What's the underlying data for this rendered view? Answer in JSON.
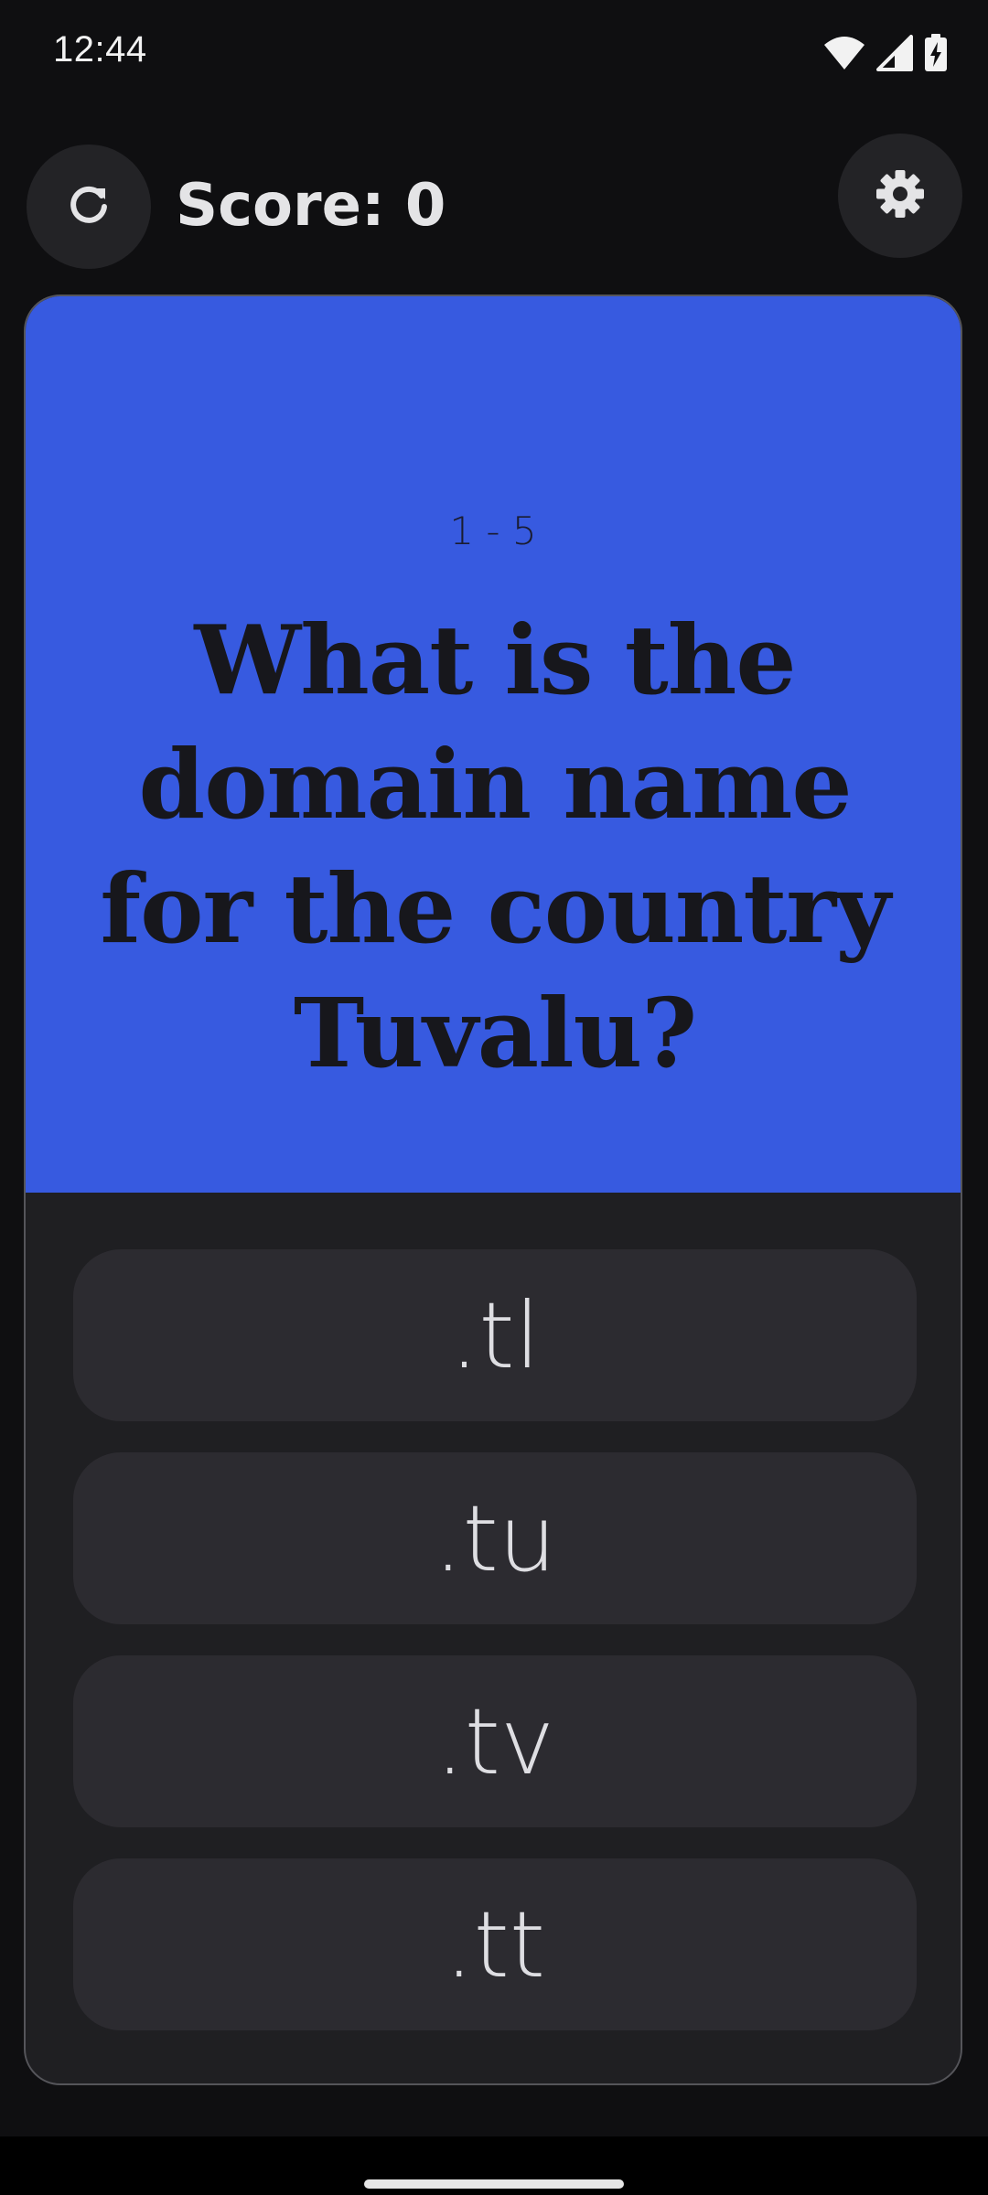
{
  "status_bar": {
    "time": "12:44",
    "icons": [
      "wifi-icon",
      "signal-icon",
      "battery-charging-icon"
    ]
  },
  "top_bar": {
    "refresh_icon": "refresh-icon",
    "score_text": "Score: 0",
    "settings_icon": "gear-icon"
  },
  "question": {
    "counter": "1 - 5",
    "text": "What is the domain name for the country Tuvalu?"
  },
  "answers": [
    {
      "label": ".tl"
    },
    {
      "label": ".tu"
    },
    {
      "label": ".tv"
    },
    {
      "label": ".tt"
    }
  ],
  "colors": {
    "background": "#0f0f11",
    "question_panel": "#375ae0",
    "answer_button": "#2c2b30",
    "card": "#1f1f22"
  }
}
